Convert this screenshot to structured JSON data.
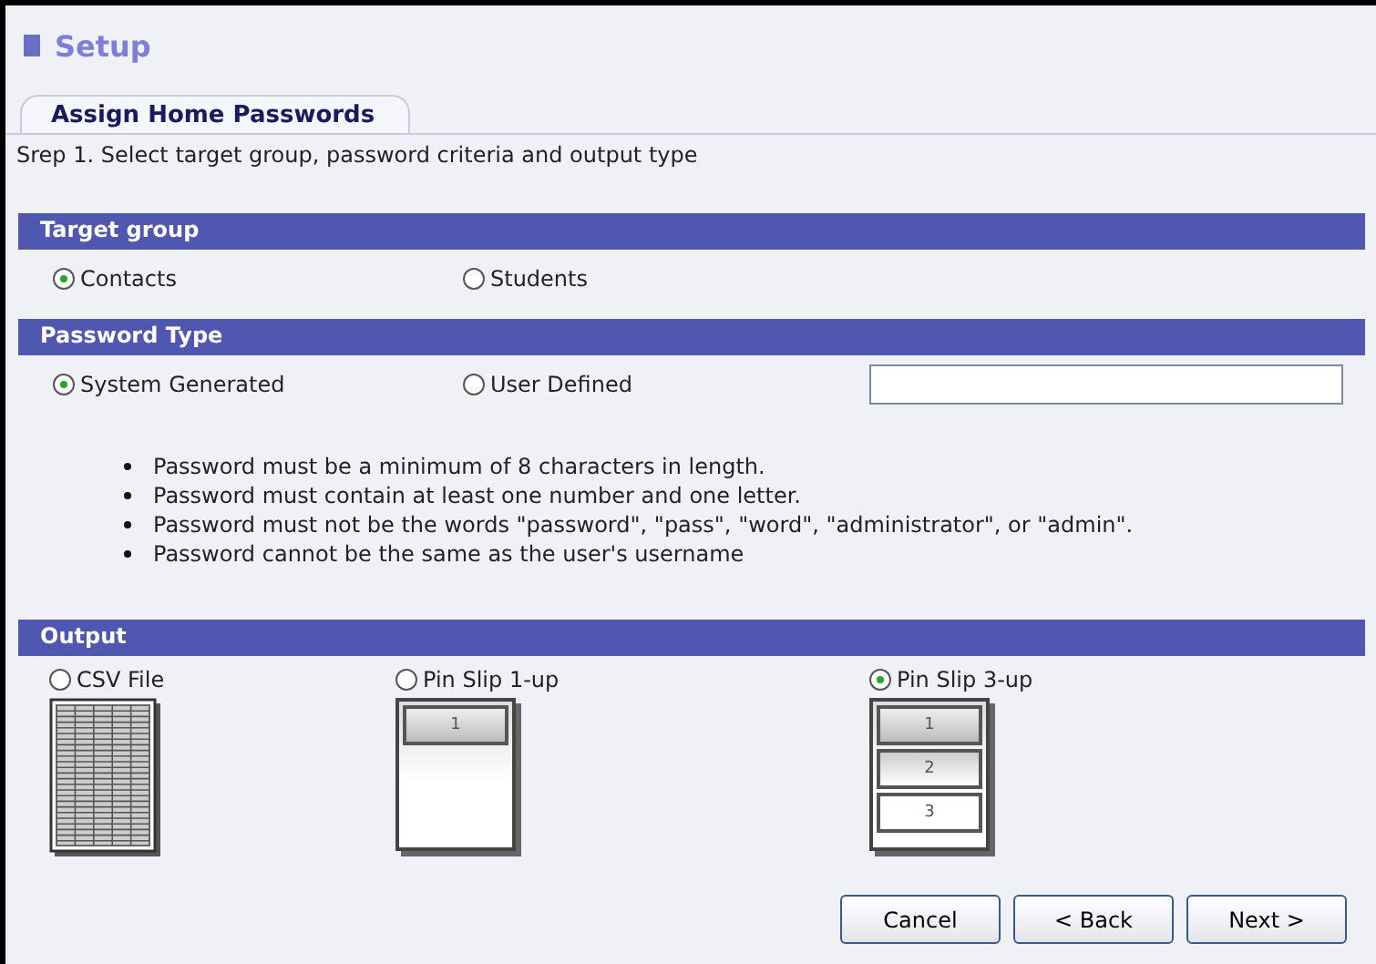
{
  "header": {
    "title": "Setup"
  },
  "tabs": [
    {
      "label": "Assign Home Passwords",
      "selected": true
    }
  ],
  "step_text": "Srep 1. Select target group, password criteria and output type",
  "target_group": {
    "title": "Target group",
    "options": [
      {
        "label": "Contacts",
        "selected": true
      },
      {
        "label": "Students",
        "selected": false
      }
    ]
  },
  "password_type": {
    "title": "Password Type",
    "options": [
      {
        "label": "System Generated",
        "selected": true
      },
      {
        "label": "User Defined",
        "selected": false
      }
    ],
    "rules": [
      "Password must be a minimum of 8 characters in length.",
      "Password must contain at least one number and one letter.",
      "Password must not be the words \"password\", \"pass\", \"word\", \"administrator\", or \"admin\".",
      "Password cannot be the same as the user's username"
    ]
  },
  "output": {
    "title": "Output",
    "options": [
      {
        "label": "CSV File",
        "selected": false,
        "kind": "csv"
      },
      {
        "label": "Pin Slip 1-up",
        "selected": false,
        "kind": "slip",
        "slots": [
          "1"
        ]
      },
      {
        "label": "Pin Slip 3-up",
        "selected": true,
        "kind": "slip",
        "slots": [
          "1",
          "2",
          "3"
        ]
      }
    ]
  },
  "buttons": [
    "Cancel",
    "< Back",
    "Next >"
  ]
}
